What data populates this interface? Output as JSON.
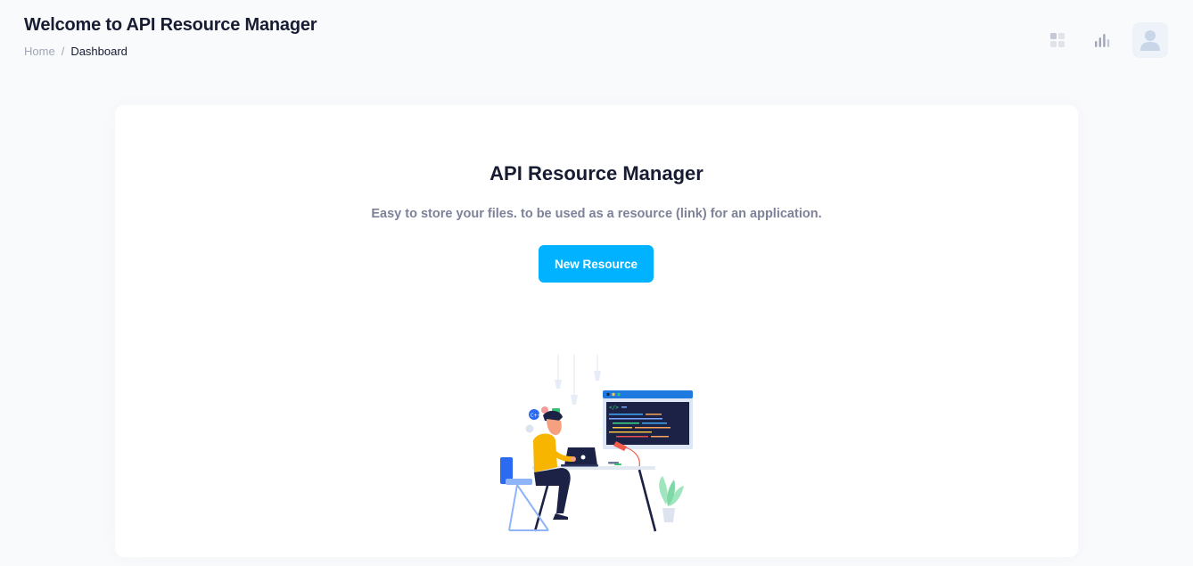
{
  "header": {
    "title": "Welcome to API Resource Manager",
    "breadcrumb": {
      "home": "Home",
      "separator": "/",
      "current": "Dashboard"
    }
  },
  "toolbar": {
    "icons": [
      "grid-icon",
      "bar-chart-icon",
      "user-avatar-icon"
    ]
  },
  "hero": {
    "title": "API Resource Manager",
    "subtitle": "Easy to store your files. to be used as a resource (link) for an application.",
    "button_label": "New Resource",
    "illustration": "developer-at-desk-illustration"
  },
  "colors": {
    "primary": "#00b2ff",
    "background": "#f9fafc",
    "heading": "#181c32",
    "muted": "#7e8299"
  }
}
